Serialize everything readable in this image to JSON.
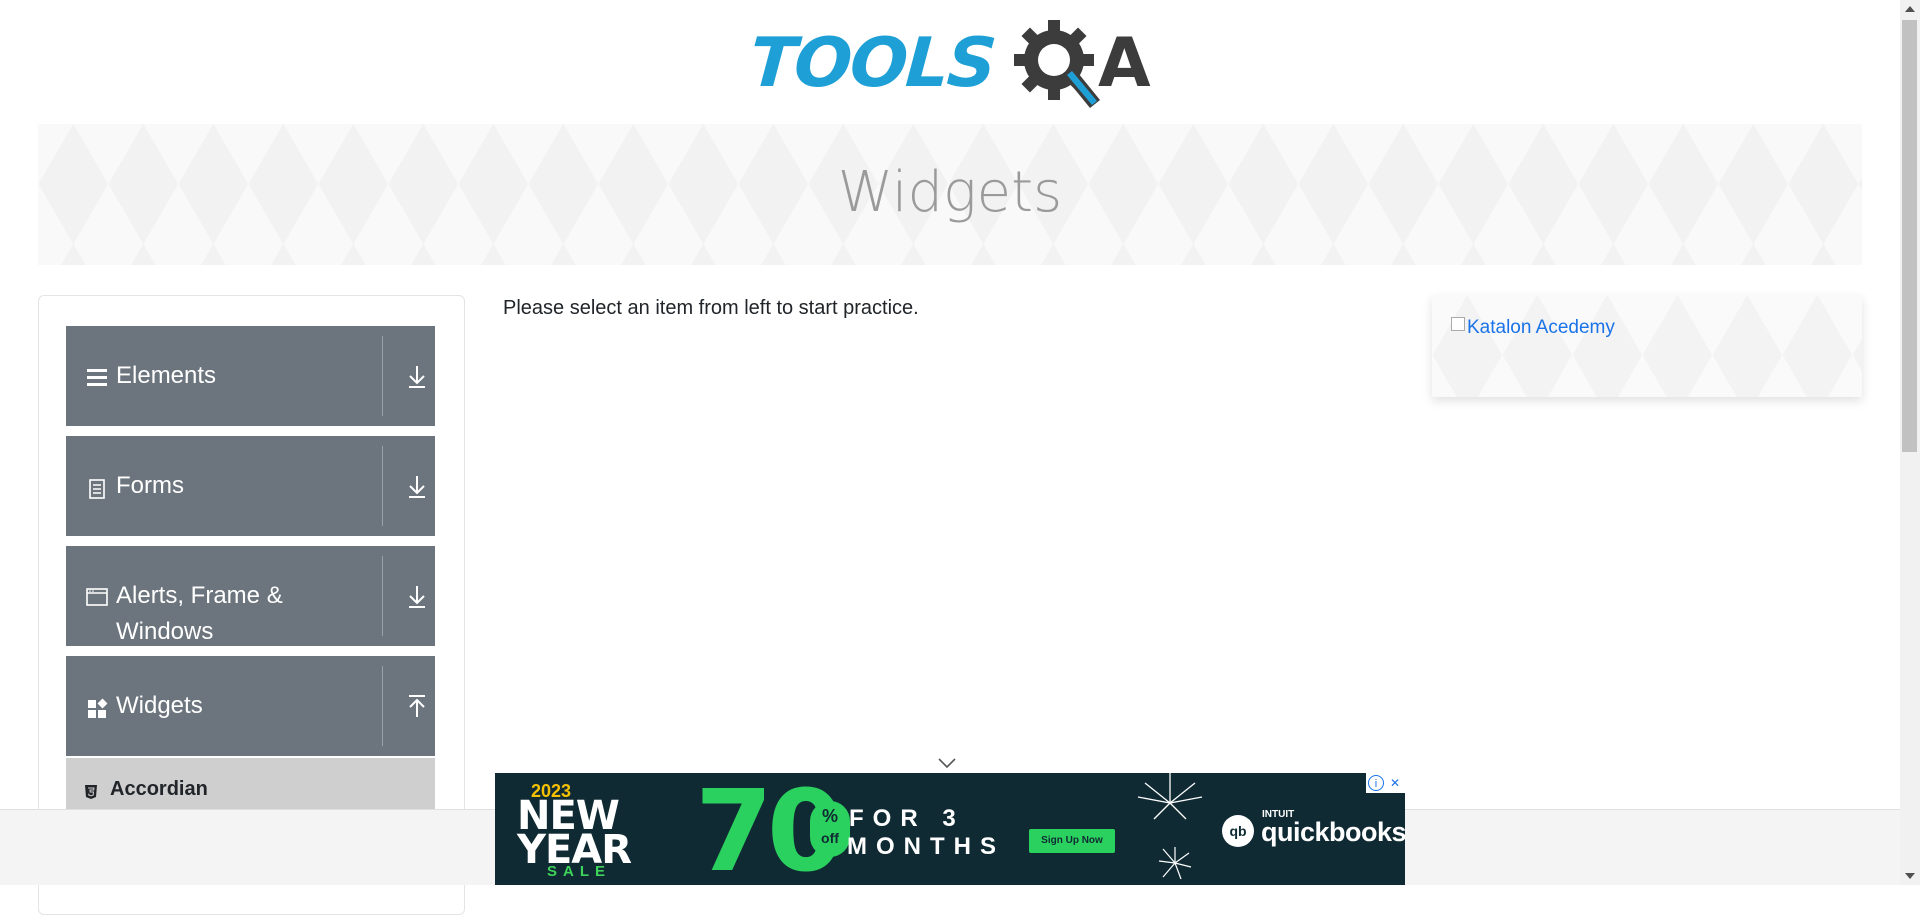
{
  "header": {
    "logo_tools": "TOOLS",
    "logo_qa": "A",
    "logo_alt": "TOOLSQA"
  },
  "banner": {
    "title": "Widgets"
  },
  "sidebar": {
    "groups": [
      {
        "label": "Elements",
        "icon": "hamburger-icon",
        "expanded": false
      },
      {
        "label": "Forms",
        "icon": "document-icon",
        "expanded": false
      },
      {
        "label": "Alerts, Frame & Windows",
        "icon": "window-icon",
        "expanded": false
      },
      {
        "label": "Widgets",
        "icon": "widgets-icon",
        "expanded": true
      }
    ],
    "widget_items": [
      {
        "label": "Accordian",
        "icon": "html5-icon"
      }
    ]
  },
  "main": {
    "instruction": "Please select an item from left to start practice."
  },
  "right_ad": {
    "alt_text": "Katalon Acedemy"
  },
  "bottom_ad": {
    "year": "2023",
    "line1": "NEW",
    "line2": "YEAR",
    "sale": "SALE",
    "discount": "70",
    "percent_sign": "%",
    "off": "off",
    "line_for": "FOR 3",
    "line_months": "MONTHS",
    "cta": "Sign Up Now",
    "brand_small": "INTUIT",
    "brand": "quickbooks",
    "brand_logo": "qb",
    "info_glyph": "i",
    "close_glyph": "✕"
  },
  "colors": {
    "sidebar_group_bg": "#6c757d",
    "sidebar_sub_bg": "#cfcfcf",
    "logo_blue": "#1ea0d6",
    "logo_dark": "#3c3c3c",
    "ad_bg": "#0f2a33",
    "ad_green": "#2bd15e"
  }
}
